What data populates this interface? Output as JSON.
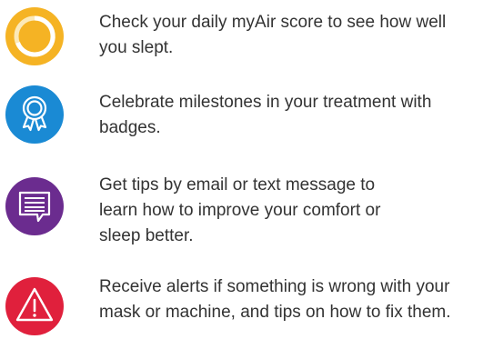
{
  "features": [
    {
      "icon": "score-ring-icon",
      "color": "#f5b324",
      "text": "Check your daily myAir score to see how well you slept."
    },
    {
      "icon": "award-ribbon-icon",
      "color": "#1a8ad4",
      "text": "Celebrate milestones in your treatment with badges."
    },
    {
      "icon": "message-bubble-icon",
      "color": "#6b2c8f",
      "text": "Get tips by email or text message to learn how to improve your comfort or sleep better."
    },
    {
      "icon": "warning-triangle-icon",
      "color": "#e0203c",
      "text": "Receive alerts if something is wrong with your mask or machine, and tips on how to fix them."
    }
  ]
}
